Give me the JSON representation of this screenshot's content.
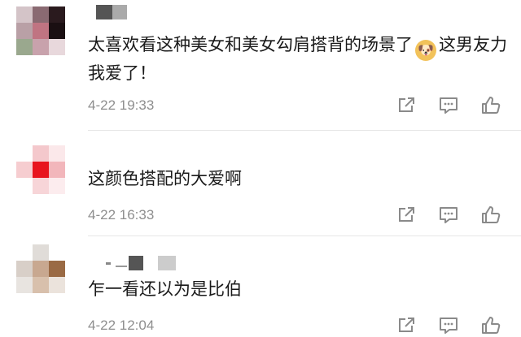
{
  "comments": [
    {
      "text_part1": "太喜欢看这种美女和美女勾肩搭背的场景了",
      "emoji": "🐶",
      "text_part2": "这男友力我爱了！",
      "time": "4-22 19:33"
    },
    {
      "text": "这颜色搭配的大爱啊",
      "time": "4-22 16:33"
    },
    {
      "text": "乍一看还以为是比伯",
      "time": "4-22 12:04"
    }
  ],
  "icons": {
    "share": "share-icon",
    "comment": "comment-icon",
    "like": "thumbs-up-icon"
  },
  "colors": {
    "text": "#1a1a1a",
    "meta": "#8e8e8e",
    "icon": "#8a8a8a"
  }
}
